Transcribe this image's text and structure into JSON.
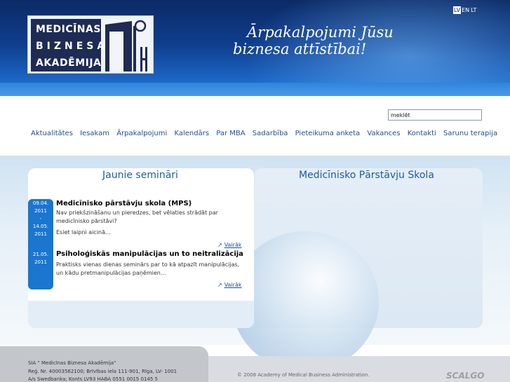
{
  "header": {
    "logo": {
      "line1": "MEDICĪNAS",
      "line2": "BIZNESA",
      "line3": "AKADĒMIJA"
    },
    "slogan_line1": "Ārpakalpojumi Jūsu",
    "slogan_line2": "biznesa attīstībai!",
    "languages": [
      "LV",
      "EN",
      "LT"
    ]
  },
  "search": {
    "value": "meklēt"
  },
  "nav": {
    "items": [
      "Aktualitātes",
      "Iesakam",
      "Ārpakalpojumi",
      "Kalendārs",
      "Par MBA",
      "Sadarbība",
      "Pieteikuma anketa",
      "Vakances",
      "Kontakti",
      "Sarunu terapija"
    ]
  },
  "left_panel": {
    "title": "Jaunie semināri",
    "items": [
      {
        "date_lines": [
          "09.04.",
          "2011",
          "-",
          "14.05.",
          "2011"
        ],
        "title": "Medicīnisko pārstāvju skola (MPS)",
        "text_lines": [
          "Nav priekšzināšanu un pieredzes, bet vēlaties strādāt par",
          "medicīnisko pārstāvi?",
          "Esiet laipni aicinā..."
        ],
        "more": "Vairāk"
      },
      {
        "date_lines": [
          "21.05.",
          "2011"
        ],
        "title": "Psiholoģiskās manipulācijas un to neitralizācija",
        "text_lines": [
          "Praktisks vienas dienas seminārs par to kā atpazīt manipulācijas,",
          "un kādu pretmanipulācijas paņēmien..."
        ],
        "more": "Vairāk"
      }
    ]
  },
  "right_panel": {
    "title": "Medicīnisko Pārstāvju Skola"
  },
  "footer": {
    "lines": [
      "SIA \" Medicīnas Biznesa Akadēmija\"",
      "Reģ. Nr. 40003562100; Brīvības iela 111-901, Rīga, LV- 1001",
      "A/s Swedbanka; Konts LV93 HABA 0551 0015 0145 5"
    ],
    "copyright": "© 2008 Academy of Medical Business Administration.",
    "brand": "SCALGO"
  },
  "colors": {
    "header_dark": "#0c2a66",
    "header_light": "#2a7ad6",
    "nav_link": "#1b4f93",
    "panel_title": "#1e5aa8",
    "date_bar": "#1a76cf"
  },
  "icons": [
    "more-arrow-icon",
    "globe-image"
  ]
}
